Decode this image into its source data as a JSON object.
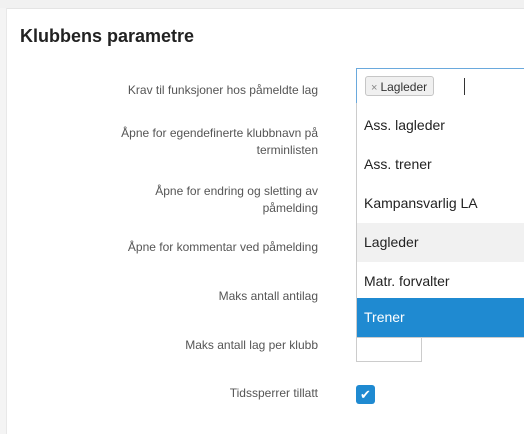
{
  "section": {
    "title": "Klubbens parametre"
  },
  "fields": [
    {
      "label": "Krav til funksjoner hos påmeldte lag"
    },
    {
      "label_line1": "Åpne for egendefinerte klubbnavn på",
      "label_line2": "terminlisten"
    },
    {
      "label_line1": "Åpne for endring og sletting av",
      "label_line2": "påmelding"
    },
    {
      "label": "Åpne for kommentar ved påmelding"
    },
    {
      "label": "Maks antall antilag"
    },
    {
      "label": "Maks antall lag per klubb"
    },
    {
      "label": "Tidssperrer tillatt"
    }
  ],
  "tag_input": {
    "tags": [
      {
        "label": "Lagleder",
        "remove_symbol": "×"
      }
    ]
  },
  "dropdown": {
    "options": [
      {
        "label": "Ass. lagleder",
        "state": "normal"
      },
      {
        "label": "Ass. trener",
        "state": "normal"
      },
      {
        "label": "Kampansvarlig LA",
        "state": "normal"
      },
      {
        "label": "Lagleder",
        "state": "hover"
      },
      {
        "label": "Matr. forvalter",
        "state": "normal"
      },
      {
        "label": "Trener",
        "state": "selected"
      }
    ]
  },
  "checkbox": {
    "checked": true,
    "glyph": "✔"
  },
  "colors": {
    "accent": "#1f8ad1",
    "focus_border": "#6aa9dd"
  }
}
